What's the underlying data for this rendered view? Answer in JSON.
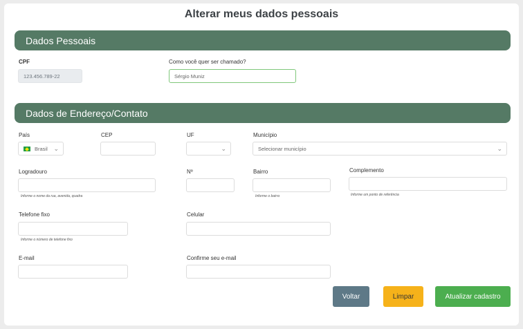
{
  "page_title": "Alterar meus dados pessoais",
  "sections": {
    "personal": "Dados Pessoais",
    "address": "Dados de Endereço/Contato"
  },
  "fields": {
    "cpf": {
      "label": "CPF",
      "value": "123.456.789-22"
    },
    "nickname": {
      "label": "Como você quer ser chamado?",
      "value": "Sérgio Muniz"
    },
    "pais": {
      "label": "País",
      "value": "Brasil",
      "icon": "brazil-flag-icon"
    },
    "cep": {
      "label": "CEP",
      "value": ""
    },
    "uf": {
      "label": "UF",
      "value": ""
    },
    "municipio": {
      "label": "Município",
      "placeholder": "Selecionar município"
    },
    "logradouro": {
      "label": "Logradouro",
      "hint": "Informe o nome da rua, avenida, quadra"
    },
    "numero": {
      "label": "Nº"
    },
    "bairro": {
      "label": "Bairro",
      "hint": "Informe o bairro"
    },
    "complemento": {
      "label": "Complemento",
      "hint": "Informe um ponto de referência"
    },
    "telefone": {
      "label": "Telefone fixo",
      "hint": "Informe o número de telefone fixo"
    },
    "celular": {
      "label": "Celular"
    },
    "email": {
      "label": "E-mail"
    },
    "email_confirm": {
      "label": "Confirme seu e-mail"
    }
  },
  "buttons": {
    "back": "Voltar",
    "clear": "Limpar",
    "submit": "Atualizar cadastro"
  },
  "colors": {
    "section_header": "#557a65",
    "back": "#5e7987",
    "clear": "#f6b21a",
    "submit": "#4cae4f",
    "focus_border": "#7fc77a"
  }
}
